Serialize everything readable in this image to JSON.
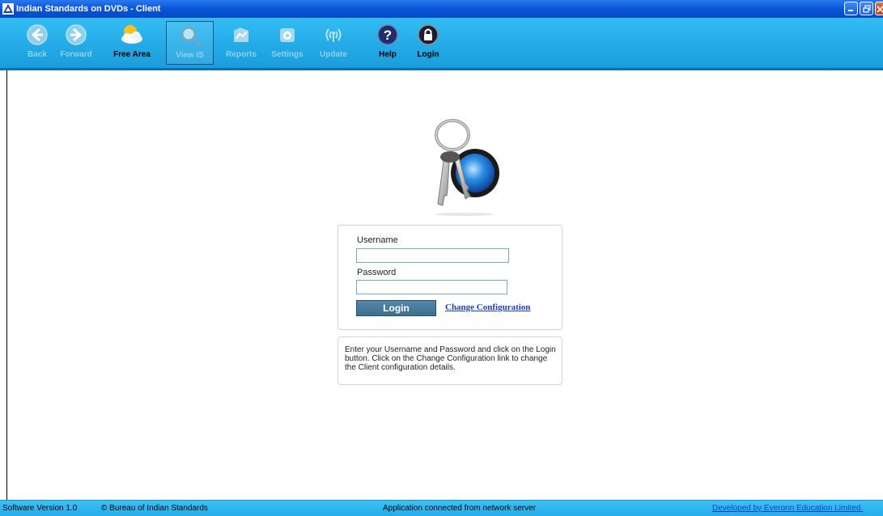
{
  "window": {
    "title": "Indian Standards on DVDs - Client",
    "title_color": "#0a58d8"
  },
  "toolbar": {
    "background": "#22a9e6",
    "buttons": [
      {
        "label": "Back",
        "icon": "back-arrow-icon",
        "enabled": false
      },
      {
        "label": "Forward",
        "icon": "forward-arrow-icon",
        "enabled": false
      },
      {
        "label": "Free Area",
        "icon": "free-area-cloud-icon",
        "enabled": true
      },
      {
        "label": "View IS",
        "icon": "magnifier-icon",
        "enabled": false,
        "pressed": true
      },
      {
        "label": "Reports",
        "icon": "reports-icon",
        "enabled": false
      },
      {
        "label": "Settings",
        "icon": "settings-icon",
        "enabled": false
      },
      {
        "label": "Update",
        "icon": "update-signal-icon",
        "enabled": false
      },
      {
        "label": "Help",
        "icon": "help-question-icon",
        "enabled": true
      },
      {
        "label": "Login",
        "icon": "lock-icon",
        "enabled": true
      }
    ]
  },
  "login": {
    "username_label": "Username",
    "username_value": "",
    "password_label": "Password",
    "password_value": "",
    "login_button": "Login",
    "change_config_link": "Change Configuration",
    "help_text": "Enter your Username and Password and click on the Login button. Click on the Change Configuration link to change the Client configuration details."
  },
  "status": {
    "version": "Software Version 1.0",
    "copyright": "© Bureau of Indian Standards",
    "connection": "Application connected from network server",
    "developer_link": "Developed by Everonn Education Limited."
  }
}
